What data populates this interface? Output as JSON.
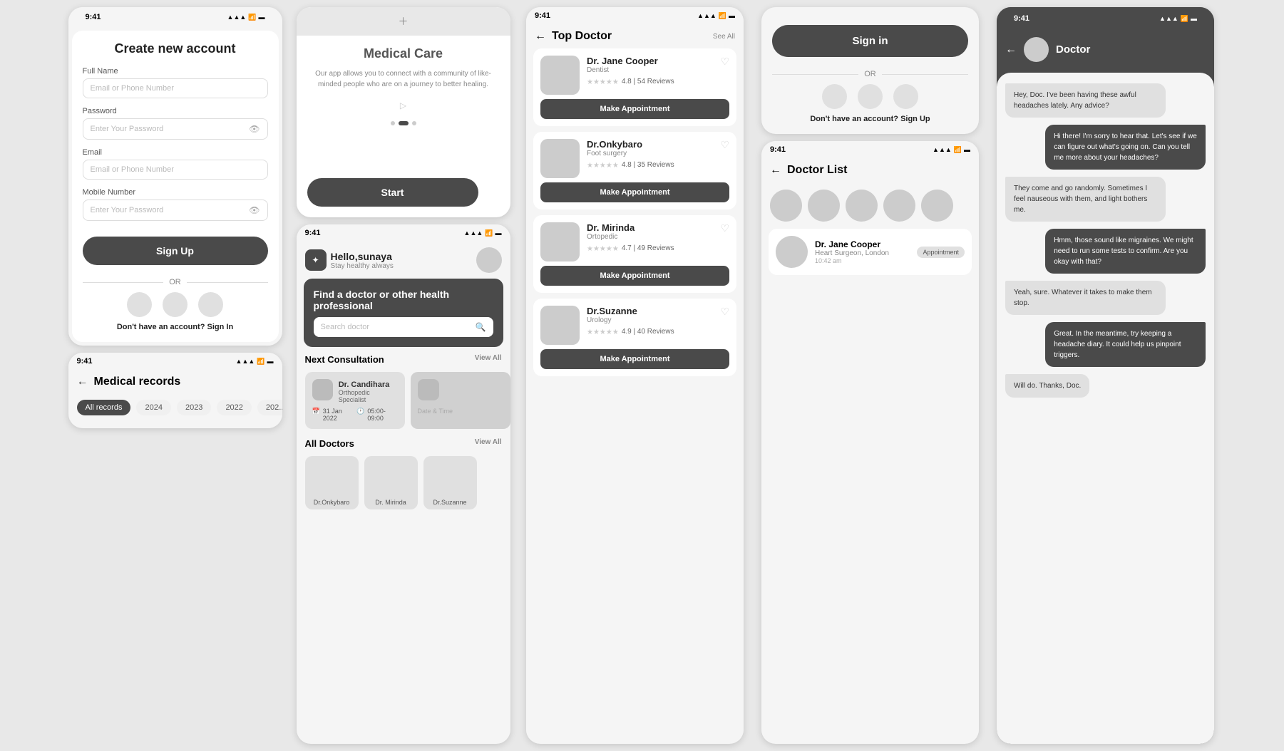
{
  "screens": {
    "create_account": {
      "status_time": "9:41",
      "title": "Create new account",
      "full_name_label": "Full Name",
      "email_placeholder": "Email or Phone Number",
      "password_label": "Password",
      "password_placeholder": "Enter Your Password",
      "email_label": "Email",
      "email2_placeholder": "Email or Phone Number",
      "mobile_label": "Mobile Number",
      "mobile_placeholder": "Enter Your Password",
      "signup_btn": "Sign Up",
      "or_text": "OR",
      "no_account_text": "Don't have an account?",
      "signin_link": "Sign In"
    },
    "medical_records": {
      "status_time": "9:41",
      "title": "Medical records",
      "tabs": [
        "All records",
        "2024",
        "2023",
        "2022",
        "202..."
      ]
    },
    "onboarding": {
      "title": "Medical Care",
      "description": "Our app allows you to connect with a community of like-minded people who are on a journey to better healing.",
      "start_btn": "Start"
    },
    "home": {
      "status_time": "9:41",
      "greeting": "Hello,sunaya",
      "subtitle": "Stay healthy always",
      "search_title": "Find a doctor or other health professional",
      "search_placeholder": "Search doctor",
      "next_consult_title": "Next Consultation",
      "view_all": "View All",
      "consult_cards": [
        {
          "name": "Dr. Candihara",
          "spec": "Orthopedic Specialist",
          "date": "31 Jan 2022",
          "time": "05:00-09:00"
        }
      ],
      "all_doctors_title": "All Doctors",
      "view_all2": "View All",
      "doctor_names": [
        "Dr.Onkybaro",
        "Dr. Mirinda",
        "Dr.Suzanne"
      ]
    },
    "top_doctor": {
      "status_time": "9:41",
      "title": "Top Doctor",
      "see_all": "See All",
      "doctors": [
        {
          "name": "Dr. Jane Cooper",
          "spec": "Dentist",
          "rating": "4.8",
          "reviews": "54 Reviews",
          "btn": "Make Appointment"
        },
        {
          "name": "Dr.Onkybaro",
          "spec": "Foot surgery",
          "rating": "4.8",
          "reviews": "35 Reviews",
          "btn": "Make Appointment"
        },
        {
          "name": "Dr. Mirinda",
          "spec": "Ortopedic",
          "rating": "4.7",
          "reviews": "49 Reviews",
          "btn": "Make Appointment"
        },
        {
          "name": "Dr.Suzanne",
          "spec": "Urology",
          "rating": "4.9",
          "reviews": "40 Reviews",
          "btn": "Make Appointment"
        }
      ]
    },
    "doctor_list": {
      "status_time": "9:41",
      "title": "Doctor List",
      "doctors": [
        {
          "name": "Dr. Jane Cooper",
          "spec": "Heart Surgeon, London",
          "time": "10:42 am",
          "badge": "Appointment"
        }
      ]
    },
    "signin": {
      "title": "Sign in",
      "btn": "Sign in",
      "or_text": "OR",
      "no_account_text": "Don't have an account?",
      "signup_link": "Sign Up"
    },
    "chat": {
      "status_time": "9:41",
      "title": "Doctor",
      "messages": [
        {
          "side": "left",
          "text": "Hey, Doc. I've been having these awful headaches lately. Any advice?"
        },
        {
          "side": "right",
          "text": "Hi there! I'm sorry to hear that. Let's see if we can figure out what's going on. Can you tell me more about your headaches?"
        },
        {
          "side": "left",
          "text": "They come and go randomly. Sometimes I feel nauseous with them, and light bothers me."
        },
        {
          "side": "right",
          "text": "Hmm, those sound like migraines. We might need to run some tests to confirm. Are you okay with that?"
        },
        {
          "side": "left",
          "text": "Yeah, sure. Whatever it takes to make them stop."
        },
        {
          "side": "right",
          "text": "Great. In the meantime, try keeping a headache diary. It could help us pinpoint triggers."
        },
        {
          "side": "left",
          "text": "Will do. Thanks, Doc."
        }
      ]
    }
  }
}
